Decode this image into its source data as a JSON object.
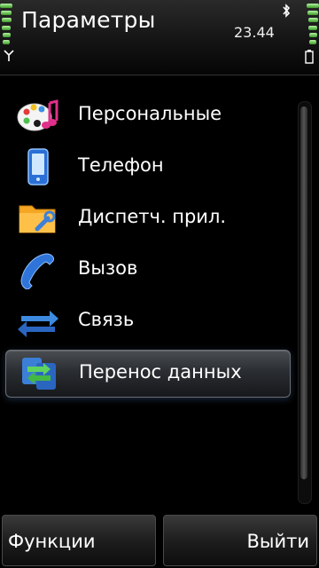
{
  "status": {
    "title": "Параметры",
    "time": "23.44",
    "icons": [
      "bluetooth-icon",
      "antenna-icon",
      "battery-icon",
      "signal-strength-icon"
    ]
  },
  "list": {
    "items": [
      {
        "label": "Персональные",
        "icon": "palette-music-icon",
        "selected": false
      },
      {
        "label": "Телефон",
        "icon": "phone-icon",
        "selected": false
      },
      {
        "label": "Диспетч. прил.",
        "icon": "folder-wrench-icon",
        "selected": false
      },
      {
        "label": "Вызов",
        "icon": "handset-icon",
        "selected": false
      },
      {
        "label": "Связь",
        "icon": "arrows-exchange-icon",
        "selected": false
      },
      {
        "label": "Перенос данных",
        "icon": "data-transfer-icon",
        "selected": true
      }
    ]
  },
  "softkeys": {
    "left": "Функции",
    "right": "Выйти"
  },
  "colors": {
    "accent_green": "#7ed36a",
    "selected_bg": "#3a3d42",
    "background": "#000000"
  }
}
